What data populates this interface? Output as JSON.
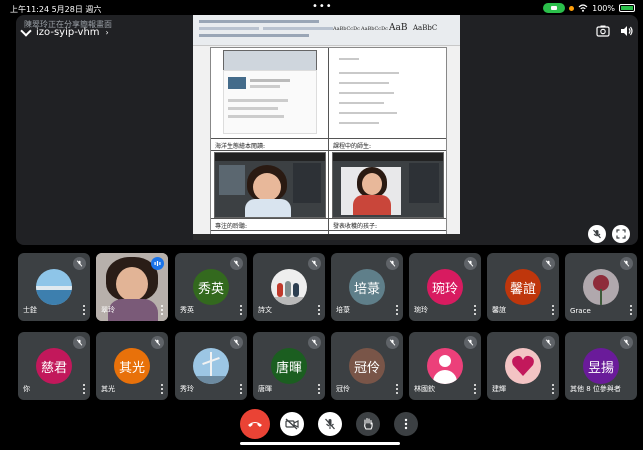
{
  "status_bar": {
    "time_date": "上午11:24  5月28日 週六",
    "battery": "100%"
  },
  "header": {
    "presenter_note": "陳翠玲正在分享簡報畫面",
    "meeting_code": "izo-syip-vhm"
  },
  "slide": {
    "styles": [
      "AaBbCcDc",
      "AaBbCcDc",
      "AaB",
      "AaBbC"
    ],
    "caption_tl": "海洋生態繪本閱讀:",
    "caption_tr": "課程中的師生:",
    "caption_bl": "專注的聆聽:",
    "caption_br": "發表收穫的孩子:"
  },
  "participants_row1": [
    {
      "name": "士銓",
      "avatar_text": "",
      "avatar_color": "#5aa7d6",
      "type": "photo-sea"
    },
    {
      "name": "翠玲",
      "avatar_text": "",
      "avatar_color": "",
      "type": "video"
    },
    {
      "name": "秀英",
      "avatar_text": "秀英",
      "avatar_color": "#33691e",
      "type": "text"
    },
    {
      "name": "詩文",
      "avatar_text": "",
      "avatar_color": "#e8e8e8",
      "type": "photo-group"
    },
    {
      "name": "培菉",
      "avatar_text": "培菉",
      "avatar_color": "#5f7f8a",
      "type": "text"
    },
    {
      "name": "琬玲",
      "avatar_text": "琬玲",
      "avatar_color": "#d81b60",
      "type": "text"
    },
    {
      "name": "馨誼",
      "avatar_text": "馨誼",
      "avatar_color": "#bf360c",
      "type": "text"
    },
    {
      "name": "Grace",
      "avatar_text": "",
      "avatar_color": "#b0a8ad",
      "type": "photo-rose"
    }
  ],
  "participants_row2": [
    {
      "name": "你",
      "avatar_text": "慈君",
      "avatar_color": "#c2185b",
      "type": "text"
    },
    {
      "name": "其光",
      "avatar_text": "其光",
      "avatar_color": "#e8710a",
      "type": "text"
    },
    {
      "name": "秀玲",
      "avatar_text": "",
      "avatar_color": "#7fb3d5",
      "type": "photo-sky"
    },
    {
      "name": "唐暉",
      "avatar_text": "唐暉",
      "avatar_color": "#1b5e20",
      "type": "text"
    },
    {
      "name": "冠伶",
      "avatar_text": "冠伶",
      "avatar_color": "#795548",
      "type": "text"
    },
    {
      "name": "林國欽",
      "avatar_text": "",
      "avatar_color": "#ec407a",
      "type": "default"
    },
    {
      "name": "建輝",
      "avatar_text": "",
      "avatar_color": "#f3c4c4",
      "type": "photo-heart"
    },
    {
      "name": "其他 8 位參與者",
      "avatar_text": "昱揚",
      "avatar_color": "#6a1b9a",
      "type": "text"
    }
  ],
  "colors": {
    "tile_bg": "#3c4043",
    "hangup": "#ea4335",
    "background": "#000000"
  },
  "icons": [
    "chevron-down-icon",
    "screenshot-icon",
    "speaker-icon",
    "mic-off-icon",
    "fullscreen-icon",
    "hangup-icon",
    "camera-off-icon",
    "raise-hand-icon",
    "more-options-icon"
  ]
}
